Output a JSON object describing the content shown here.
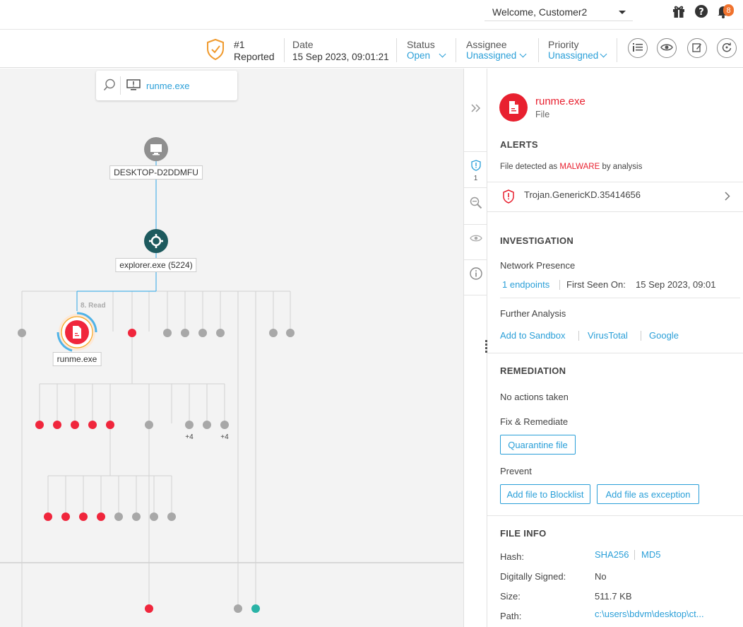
{
  "topbar": {
    "welcome": "Welcome, Customer2",
    "notifications_count": "8",
    "icons": [
      "gift-icon",
      "help-icon",
      "bell-icon"
    ]
  },
  "incident": {
    "id": "#1",
    "state": "Reported",
    "date_label": "Date",
    "date_value": "15 Sep 2023, 09:01:21",
    "status_label": "Status",
    "status_value": "Open",
    "assignee_label": "Assignee",
    "assignee_value": "Unassigned",
    "priority_label": "Priority",
    "priority_value": "Unassigned",
    "actions": [
      "info-list-icon",
      "eye-radar-icon",
      "edit-icon",
      "refresh-icon"
    ]
  },
  "graph": {
    "search_value": "runme.exe",
    "host_label": "DESKTOP-D2DDMFU",
    "process_label": "explorer.exe (5224)",
    "edge_label": "8. Read",
    "file_label": "runme.exe",
    "plus_labels": [
      "+4",
      "+4"
    ],
    "colors": {
      "red": "#f0263c",
      "grey": "#a8a8a8",
      "teal": "#2ab3a6",
      "dark_teal": "#1d5a5e",
      "line_grey": "#d2d2d2",
      "line_blue": "#4fb3e8"
    }
  },
  "strip": {
    "alerts_count": "1"
  },
  "panel": {
    "file_name": "runme.exe",
    "file_type": "File",
    "alerts_title": "ALERTS",
    "alerts_desc_prefix": "File detected as",
    "alerts_desc_highlight": "MALWARE",
    "alerts_desc_suffix": "by analysis",
    "alert_item": "Trojan.GenericKD.35414656",
    "investigation_title": "INVESTIGATION",
    "network_presence_label": "Network Presence",
    "endpoints_link": "1 endpoints",
    "first_seen_label": "First Seen On:",
    "first_seen_value": "15 Sep 2023, 09:01",
    "further_analysis_label": "Further Analysis",
    "analysis_links": [
      "Add to Sandbox",
      "VirusTotal",
      "Google"
    ],
    "remediation_title": "REMEDIATION",
    "no_actions": "No actions taken",
    "fix_label": "Fix & Remediate",
    "quarantine_btn": "Quarantine file",
    "prevent_label": "Prevent",
    "blocklist_btn": "Add file to Blocklist",
    "exception_btn": "Add file as exception",
    "file_info_title": "FILE INFO",
    "hash_label": "Hash:",
    "hash_links": [
      "SHA256",
      "MD5"
    ],
    "signed_label": "Digitally Signed:",
    "signed_value": "No",
    "size_label": "Size:",
    "size_value": "511.7 KB",
    "path_label": "Path:",
    "path_value": "c:\\users\\bdvm\\desktop\\ct...",
    "colors": {
      "accent": "#2a9fd8",
      "danger": "#e8202f"
    }
  }
}
